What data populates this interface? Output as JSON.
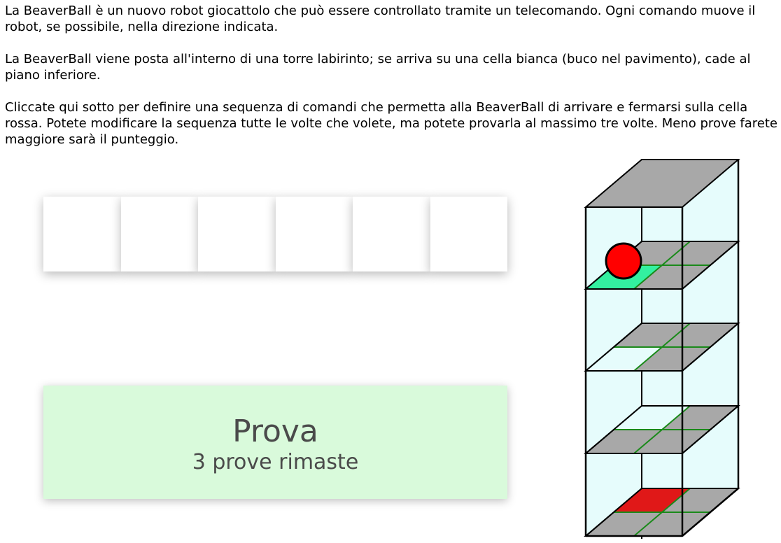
{
  "instructions": {
    "p1": "La BeaverBall è un nuovo robot giocattolo che può essere controllato tramite un telecomando. Ogni comando muove il robot, se possibile, nella direzione indicata.",
    "p2": "La BeaverBall viene posta all'interno di una torre labirinto; se arriva su una cella bianca (buco nel pavimento), cade al piano inferiore.",
    "p3": "Cliccate qui sotto per definire una sequenza di comandi che permetta alla BeaverBall di arrivare e fermarsi sulla cella rossa. Potete modificare la sequenza tutte le volte che volete, ma potete provarla al massimo tre volte. Meno prove farete maggiore sarà il punteggio."
  },
  "command_slots": [
    "",
    "",
    "",
    "",
    "",
    ""
  ],
  "try_button": {
    "label": "Prova",
    "remaining": "3 prove rimaste"
  },
  "tower": {
    "floors": 4,
    "ball_color": "#ff0000",
    "start_cell_color": "#33f0a0",
    "target_cell_color": "#e01818",
    "floor_color": "#a8a8a8",
    "glass_color": "#e6fcfc",
    "grid_line_color": "#1a8a1a"
  },
  "colors": {
    "button_bg": "#d9fadb",
    "button_text": "#4a4a4a"
  }
}
